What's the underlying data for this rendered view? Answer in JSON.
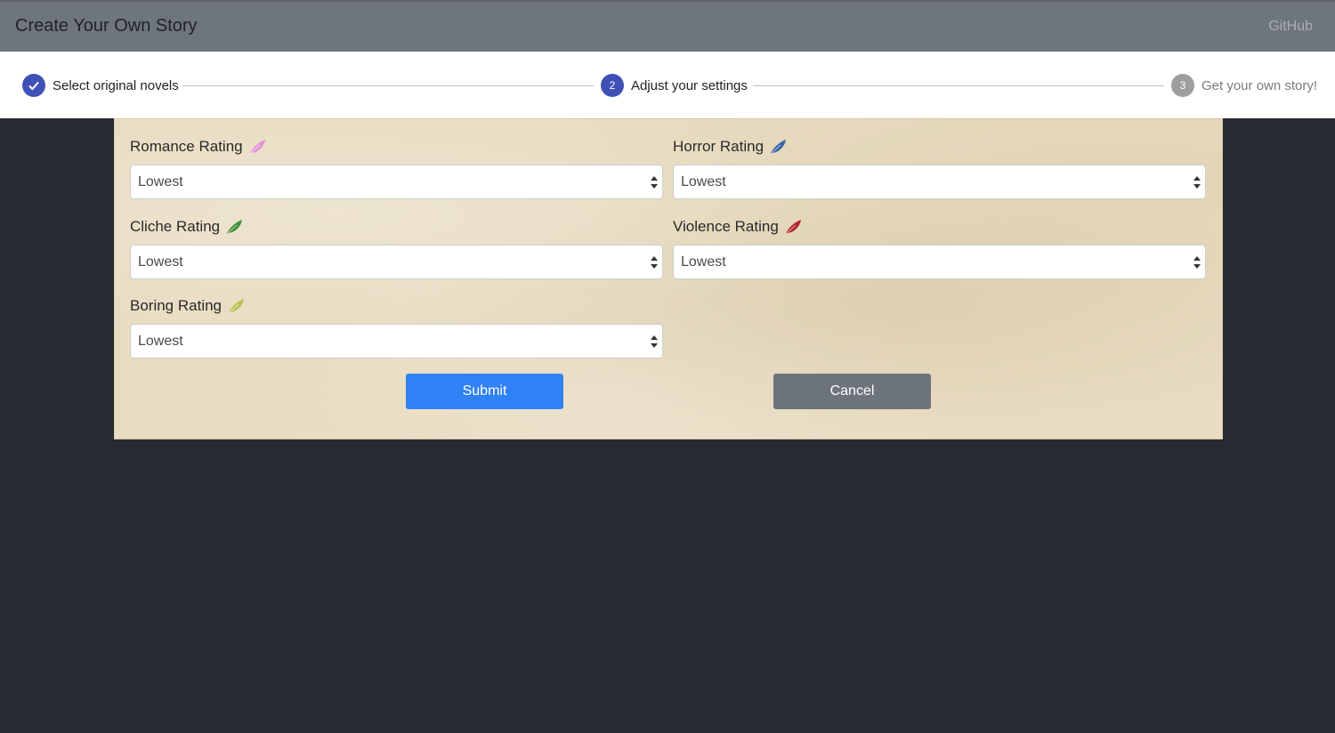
{
  "app": {
    "title": "Create Your Own Story",
    "github_link": "GitHub"
  },
  "stepper": {
    "steps": [
      {
        "label": "Select original novels",
        "number": "",
        "state": "completed",
        "icon": "check-icon"
      },
      {
        "label": "Adjust your settings",
        "number": "2",
        "state": "active"
      },
      {
        "label": "Get your own story!",
        "number": "3",
        "state": "pending"
      }
    ],
    "colors": {
      "active": "#3f51b5",
      "pending": "#9e9e9e"
    }
  },
  "form": {
    "fields": {
      "romance": {
        "label": "Romance Rating",
        "value": "Lowest",
        "icon": "feather-icon",
        "icon_color": "#e58fd8"
      },
      "horror": {
        "label": "Horror Rating",
        "value": "Lowest",
        "icon": "feather-icon",
        "icon_color": "#3b63a8"
      },
      "cliche": {
        "label": "Cliche Rating",
        "value": "Lowest",
        "icon": "feather-icon",
        "icon_color": "#3e8e3a"
      },
      "violence": {
        "label": "Violence Rating",
        "value": "Lowest",
        "icon": "feather-icon",
        "icon_color": "#b3232a"
      },
      "boring": {
        "label": "Boring Rating",
        "value": "Lowest",
        "icon": "feather-icon",
        "icon_color": "#b9c24e"
      }
    },
    "buttons": {
      "submit": "Submit",
      "cancel": "Cancel"
    },
    "colors": {
      "primary": "#3182f6",
      "secondary": "#6c737a"
    }
  }
}
